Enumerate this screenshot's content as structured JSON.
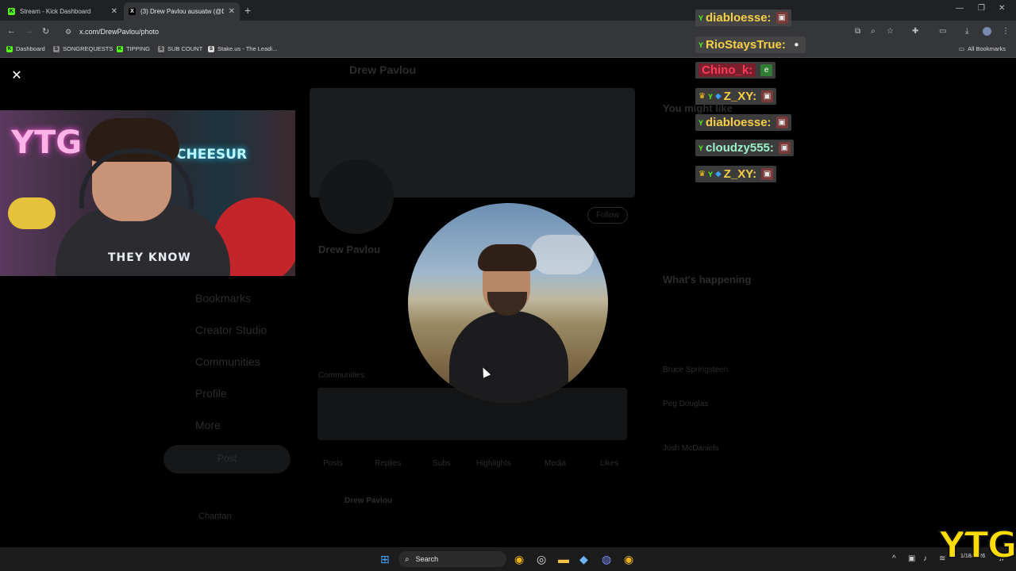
{
  "browser": {
    "tabs": [
      {
        "title": "Stream - Kick Dashboard",
        "close": "✕"
      },
      {
        "title": "(3) Drew Pavlou ausuatw (@D",
        "close": "✕"
      }
    ],
    "new_tab": "+",
    "url": "x.com/DrewPavlou/photo",
    "bookmarks": [
      "Dashboard",
      "SONGREQUESTS",
      "TIPPING",
      "SUB COUNT",
      "Stake.us - The Leadi..."
    ],
    "all_bookmarks": "All Bookmarks"
  },
  "viewer": {
    "close": "✕"
  },
  "background_page": {
    "profile_name": "Drew Pavlou",
    "follow": "Follow",
    "nav": [
      "Bookmarks",
      "Creator Studio",
      "Communities",
      "Profile",
      "More"
    ],
    "post_button": "Post",
    "you_might_like": "You might like",
    "whats_happening": "What's happening",
    "trends": [
      "Bruce Springsteen",
      "Peg Douglas",
      "Josh McDaniels"
    ],
    "communities": "Communities",
    "profile_tabs": [
      "Posts",
      "Replies",
      "Subs",
      "Highlights",
      "Media",
      "Likes"
    ],
    "post_author": "Drew Pavlou",
    "account_name": "Chantan"
  },
  "webcam": {
    "neon_left": "YTG",
    "neon_right": "CHEESUR",
    "shirt": "THEY KNOW"
  },
  "chat": [
    {
      "badges": [
        "ytg"
      ],
      "user": "diabloesse:",
      "color": "#f7d047",
      "emote": "🟥"
    },
    {
      "badges": [
        "ytg"
      ],
      "user": "RioStaysTrue:",
      "color": "#f7d047",
      "emote": "💭"
    },
    {
      "badges": [],
      "user": "Chino_k:",
      "color": "#ff3b5c",
      "emote": "🟩"
    },
    {
      "badges": [
        "crown",
        "ytg",
        "gem"
      ],
      "user": "Z_XY:",
      "color": "#f7d047",
      "emote": "🟥"
    },
    {
      "badges": [
        "ytg"
      ],
      "user": "diabloesse:",
      "color": "#f7d047",
      "emote": "🟥"
    },
    {
      "badges": [
        "ytg"
      ],
      "user": "cloudzy555:",
      "color": "#9af0c8",
      "emote": "🟥"
    },
    {
      "badges": [
        "crown",
        "ytg",
        "gem"
      ],
      "user": "Z_XY:",
      "color": "#f7d047",
      "emote": "🟥"
    }
  ],
  "taskbar": {
    "search": "Search",
    "date": "1/18/2026"
  },
  "overlay_logo": "YTG"
}
